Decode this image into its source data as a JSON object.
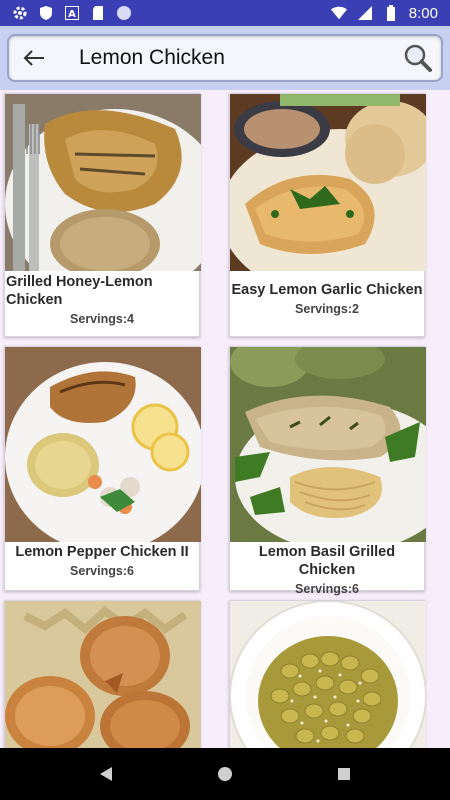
{
  "status_bar": {
    "time": "8:00",
    "left_icons": [
      "settings-icon",
      "shield-icon",
      "a-icon",
      "sd-card-icon",
      "circle-icon"
    ],
    "right_icons": [
      "wifi-icon",
      "signal-icon",
      "battery-icon"
    ],
    "color": "#3a3fb3"
  },
  "search": {
    "query": "Lemon Chicken"
  },
  "recipes": [
    {
      "title": "Grilled Honey-Lemon Chicken",
      "servings": "Servings:4"
    },
    {
      "title": "Easy Lemon Garlic Chicken",
      "servings": "Servings:2"
    },
    {
      "title": "Lemon Pepper Chicken II",
      "servings": "Servings:6"
    },
    {
      "title": "Lemon Basil Grilled Chicken",
      "servings": "Servings:6"
    },
    {
      "title": "",
      "servings": ""
    },
    {
      "title": "",
      "servings": ""
    }
  ],
  "colors": {
    "app_bar": "#c8d0f2",
    "background": "#f7eefc"
  }
}
